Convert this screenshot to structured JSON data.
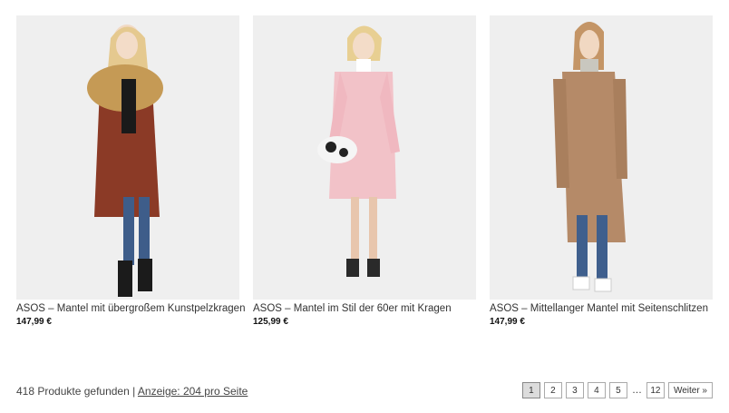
{
  "products": [
    {
      "title": "ASOS – Mantel mit übergroßem Kunstpelzkragen",
      "price": "147,99 €",
      "coat_color": "#8b3a26",
      "collar_color": "#c59a55"
    },
    {
      "title": "ASOS – Mantel im Stil der 60er mit Kragen",
      "price": "125,99 €",
      "coat_color": "#f2c2c8"
    },
    {
      "title": "ASOS – Mittellanger Mantel mit Seitenschlitzen",
      "price": "147,99 €",
      "coat_color": "#b58a68"
    }
  ],
  "footer": {
    "count_text": "418 Produkte gefunden",
    "separator": "|",
    "display_link": "Anzeige: 204 pro Seite"
  },
  "pagination": {
    "pages": [
      "1",
      "2",
      "3",
      "4",
      "5"
    ],
    "ellipsis": "…",
    "last": "12",
    "next": "Weiter »",
    "current": "1"
  }
}
